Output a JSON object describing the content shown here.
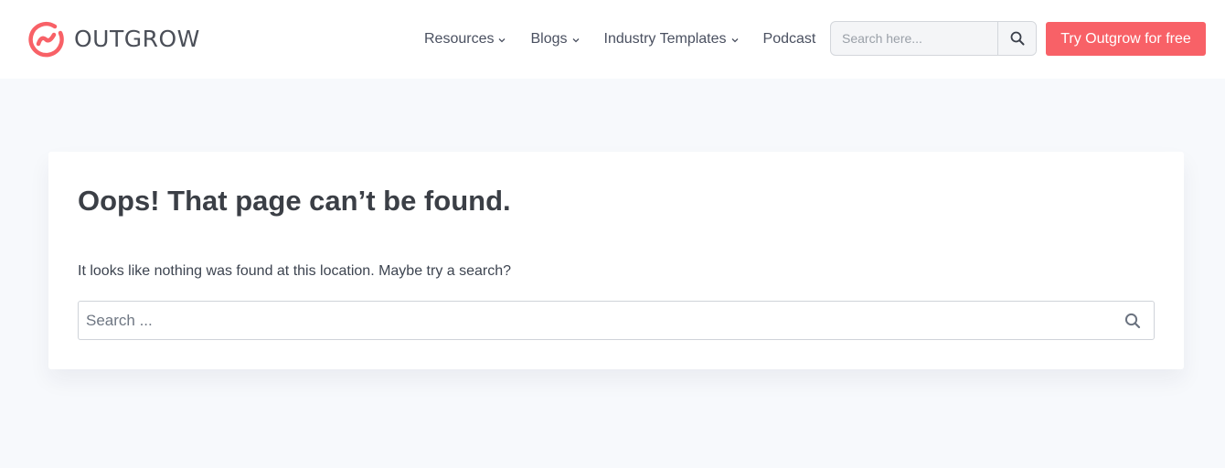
{
  "brand": {
    "name": "OUTGROW",
    "accent_color": "#f86167"
  },
  "nav": {
    "items": [
      {
        "label": "Resources",
        "has_dropdown": true
      },
      {
        "label": "Blogs",
        "has_dropdown": true
      },
      {
        "label": "Industry Templates",
        "has_dropdown": true
      },
      {
        "label": "Podcast",
        "has_dropdown": false
      }
    ]
  },
  "header_search": {
    "placeholder": "Search here...",
    "icon": "search-icon"
  },
  "cta": {
    "label": "Try Outgrow for free"
  },
  "error": {
    "title": "Oops! That page can’t be found.",
    "message": "It looks like nothing was found at this location. Maybe try a search?"
  },
  "main_search": {
    "placeholder": "Search ...",
    "icon": "search-icon"
  }
}
